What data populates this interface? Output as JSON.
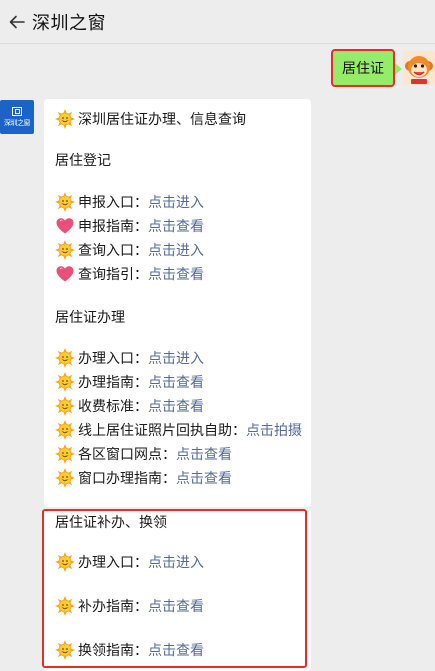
{
  "header": {
    "title": "深圳之窗",
    "back_icon": "back-arrow-icon"
  },
  "user_message": {
    "text": "居住证",
    "bubble_color": "#95ec69",
    "highlight_color": "#e82c2c"
  },
  "bot": {
    "avatar_text": "深圳之窗",
    "avatar_color": "#1b63c6",
    "intro": "深圳居住证办理、信息查询",
    "section1": {
      "title": "居住登记",
      "items": [
        {
          "icon": "sun-icon",
          "label": "申报入口：",
          "link": "点击进入"
        },
        {
          "icon": "heart-icon",
          "label": "申报指南：",
          "link": "点击查看"
        },
        {
          "icon": "sun-icon",
          "label": "查询入口：",
          "link": "点击进入"
        },
        {
          "icon": "heart-icon",
          "label": "查询指引：",
          "link": "点击查看"
        }
      ]
    },
    "section2": {
      "title": "居住证办理",
      "items": [
        {
          "icon": "sun-icon",
          "label": "办理入口：",
          "link": "点击进入"
        },
        {
          "icon": "sun-icon",
          "label": "办理指南：",
          "link": "点击查看"
        },
        {
          "icon": "sun-icon",
          "label": "收费标准：",
          "link": "点击查看"
        },
        {
          "icon": "sun-icon",
          "label": "线上居住证照片回执自助：",
          "link": "点击拍摄"
        },
        {
          "icon": "sun-icon",
          "label": "各区窗口网点：",
          "link": "点击查看"
        },
        {
          "icon": "sun-icon",
          "label": "窗口办理指南：",
          "link": "点击查看"
        }
      ]
    },
    "section3": {
      "title": "居住证补办、换领",
      "items": [
        {
          "icon": "sun-icon",
          "label": "办理入口：",
          "link": "点击进入"
        },
        {
          "icon": "sun-icon",
          "label": "补办指南：",
          "link": "点击查看"
        },
        {
          "icon": "sun-icon",
          "label": "换领指南：",
          "link": "点击查看"
        }
      ]
    },
    "link_color": "#576b95"
  }
}
